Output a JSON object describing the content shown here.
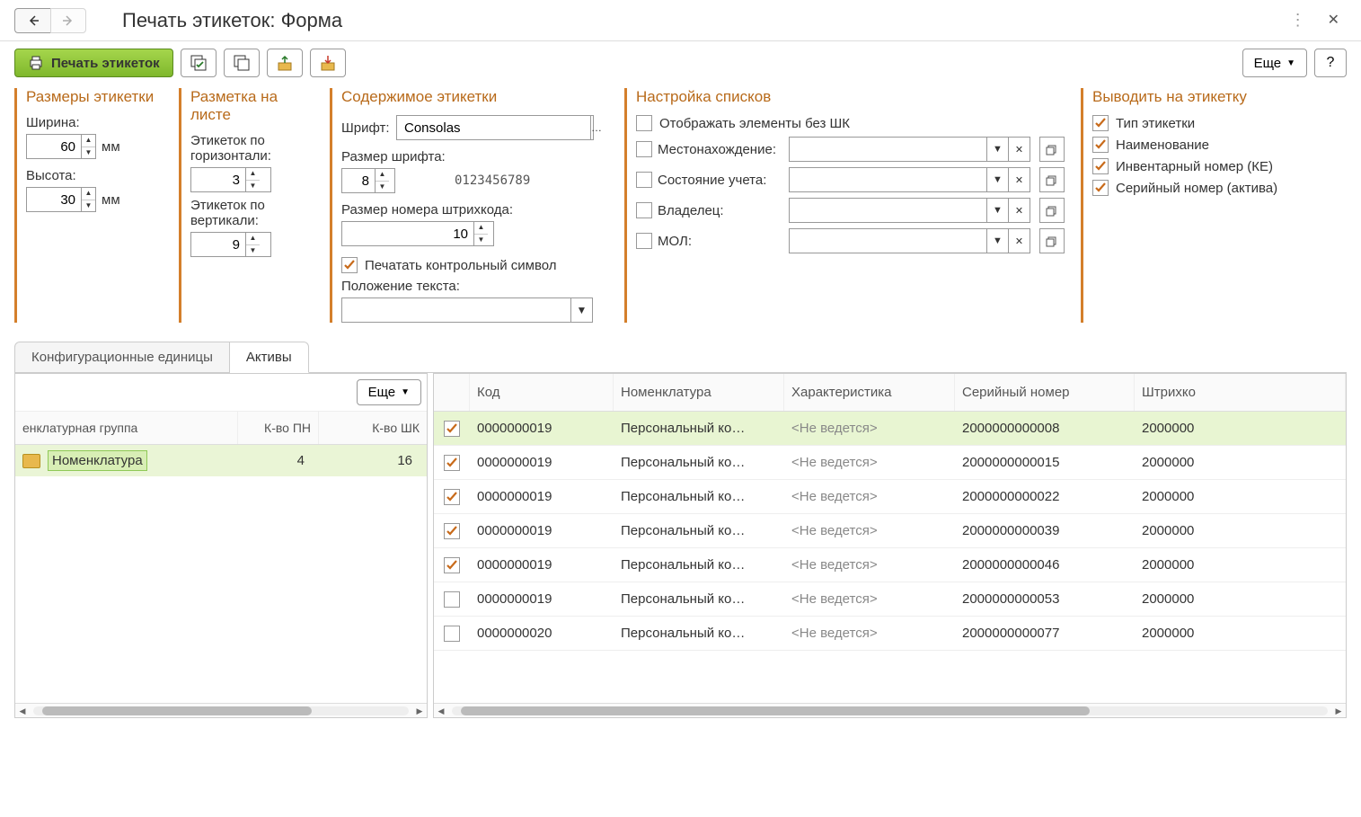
{
  "header": {
    "title": "Печать этикеток: Форма"
  },
  "toolbar": {
    "print": "Печать этикеток",
    "more": "Еще",
    "help": "?"
  },
  "dims": {
    "title": "Размеры этикетки",
    "width_label": "Ширина:",
    "width": "60",
    "width_unit": "мм",
    "height_label": "Высота:",
    "height": "30",
    "height_unit": "мм"
  },
  "layout": {
    "title": "Разметка на листе",
    "horiz_label": "Этикеток по горизонтали:",
    "horiz": "3",
    "vert_label": "Этикеток по вертикали:",
    "vert": "9"
  },
  "content": {
    "title": "Содержимое этикетки",
    "font_label": "Шрифт:",
    "font": "Consolas",
    "size_label": "Размер шрифта:",
    "size": "8",
    "sample": "0123456789",
    "bc_size_label": "Размер номера штрихкода:",
    "bc_size": "10",
    "control_char": "Печатать контрольный символ",
    "text_pos_label": "Положение текста:",
    "text_pos": ""
  },
  "lists": {
    "title": "Настройка списков",
    "no_bc": "Отображать элементы без ШК",
    "location": "Местонахождение:",
    "status": "Состояние учета:",
    "owner": "Владелец:",
    "mol": "МОЛ:"
  },
  "output": {
    "title": "Выводить на этикетку",
    "items": [
      "Тип этикетки",
      "Наименование",
      "Инвентарный номер (КЕ)",
      "Серийный номер (актива)"
    ]
  },
  "tabs": {
    "config": "Конфигурационные единицы",
    "assets": "Активы"
  },
  "left_panel": {
    "more": "Еще",
    "col1": "енклатурная группа",
    "col2": "К-во ПН",
    "col3": "К-во ШК",
    "row": {
      "name": "Номенклатура",
      "pn": "4",
      "bc": "16"
    }
  },
  "grid": {
    "cols": {
      "code": "Код",
      "nom": "Номенклатура",
      "char": "Характеристика",
      "ser": "Серийный номер",
      "bc": "Штрихко"
    },
    "rows": [
      {
        "checked": true,
        "sel": true,
        "code": "0000000019",
        "nom": "Персональный ко…",
        "char": "<Не ведется>",
        "ser": "2000000000008",
        "bc": "2000000"
      },
      {
        "checked": true,
        "sel": false,
        "code": "0000000019",
        "nom": "Персональный ко…",
        "char": "<Не ведется>",
        "ser": "2000000000015",
        "bc": "2000000"
      },
      {
        "checked": true,
        "sel": false,
        "code": "0000000019",
        "nom": "Персональный ко…",
        "char": "<Не ведется>",
        "ser": "2000000000022",
        "bc": "2000000"
      },
      {
        "checked": true,
        "sel": false,
        "code": "0000000019",
        "nom": "Персональный ко…",
        "char": "<Не ведется>",
        "ser": "2000000000039",
        "bc": "2000000"
      },
      {
        "checked": true,
        "sel": false,
        "code": "0000000019",
        "nom": "Персональный ко…",
        "char": "<Не ведется>",
        "ser": "2000000000046",
        "bc": "2000000"
      },
      {
        "checked": false,
        "sel": false,
        "code": "0000000019",
        "nom": "Персональный ко…",
        "char": "<Не ведется>",
        "ser": "2000000000053",
        "bc": "2000000"
      },
      {
        "checked": false,
        "sel": false,
        "code": "0000000020",
        "nom": "Персональный ко…",
        "char": "<Не ведется>",
        "ser": "2000000000077",
        "bc": "2000000"
      }
    ]
  }
}
